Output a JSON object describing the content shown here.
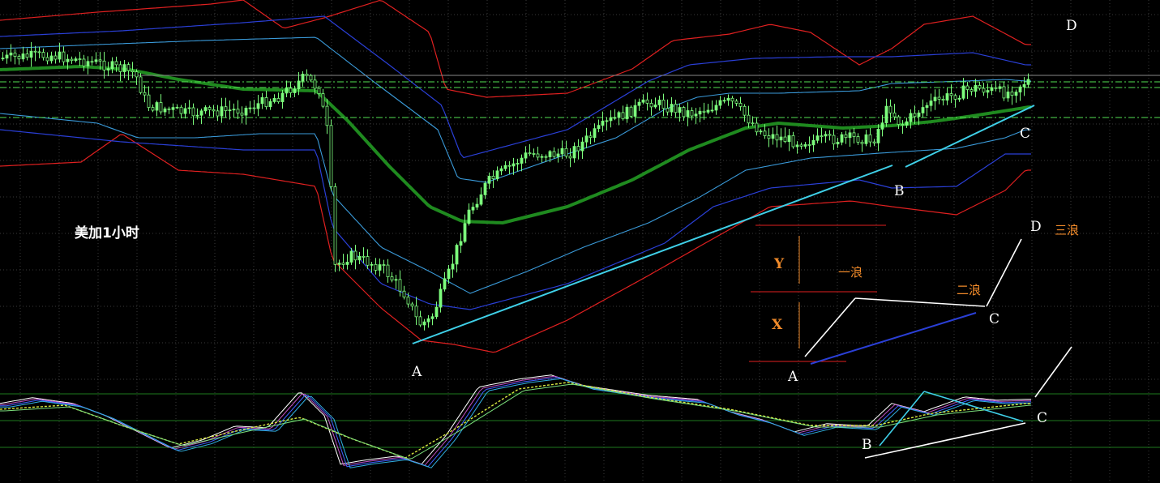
{
  "chart_data": {
    "type": "candlestick",
    "title": "美加1小时",
    "colors": {
      "background": "#000000",
      "candle": "#7cfc7c",
      "middle_band": "#1f8a1f",
      "inner_band": "#3a9ad9",
      "mid_band": "#2a3fd6",
      "outer_band": "#e02020",
      "trendline": "#3fd0e8",
      "pattern": "#ffffff",
      "pattern_blue": "#2a3fd6",
      "orange_text": "#f08a2a"
    },
    "wave_labels": {
      "top_right_d": "D",
      "main_a": "A",
      "main_b": "B",
      "main_c": "C",
      "legend_a": "A",
      "legend_c": "C",
      "legend_d": "D",
      "osc_b": "B",
      "osc_c": "C",
      "y": "Y",
      "x": "X",
      "wave1": "一浪",
      "wave2": "二浪",
      "wave3": "三浪"
    }
  }
}
